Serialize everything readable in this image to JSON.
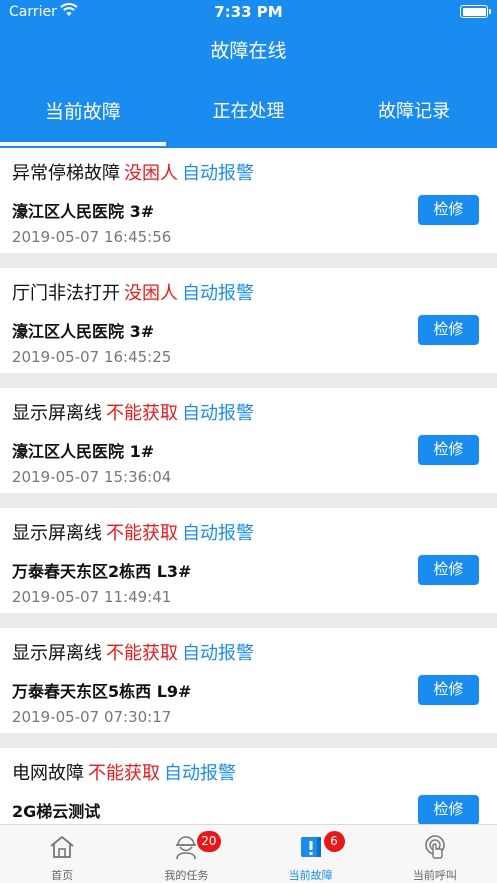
{
  "status_bar": {
    "carrier": "Carrier",
    "time": "7:33 PM"
  },
  "header": {
    "title": "故障在线"
  },
  "tabs": [
    {
      "label": "当前故障"
    },
    {
      "label": "正在处理"
    },
    {
      "label": "故障记录"
    }
  ],
  "faults": [
    {
      "fault": "异常停梯故障",
      "condition": "没困人",
      "alarm": "自动报警",
      "location": "濠江区人民医院 3#",
      "time": "2019-05-07 16:45:56",
      "action": "检修"
    },
    {
      "fault": "厅门非法打开",
      "condition": "没困人",
      "alarm": "自动报警",
      "location": "濠江区人民医院 3#",
      "time": "2019-05-07 16:45:25",
      "action": "检修"
    },
    {
      "fault": "显示屏离线",
      "condition": "不能获取",
      "alarm": "自动报警",
      "location": "濠江区人民医院 1#",
      "time": "2019-05-07 15:36:04",
      "action": "检修"
    },
    {
      "fault": "显示屏离线",
      "condition": "不能获取",
      "alarm": "自动报警",
      "location": "万泰春天东区2栋西 L3#",
      "time": "2019-05-07 11:49:41",
      "action": "检修"
    },
    {
      "fault": "显示屏离线",
      "condition": "不能获取",
      "alarm": "自动报警",
      "location": "万泰春天东区5栋西 L9#",
      "time": "2019-05-07 07:30:17",
      "action": "检修"
    },
    {
      "fault": "电网故障",
      "condition": "不能获取",
      "alarm": "自动报警",
      "location": "2G梯云测试",
      "time": "",
      "action": "检修"
    }
  ],
  "tab_bar": [
    {
      "label": "首页",
      "icon": "home-icon",
      "badge": ""
    },
    {
      "label": "我的任务",
      "icon": "worker-icon",
      "badge": "20"
    },
    {
      "label": "当前故障",
      "icon": "alert-book-icon",
      "badge": "6"
    },
    {
      "label": "当前呼叫",
      "icon": "touch-call-icon",
      "badge": ""
    }
  ],
  "colors": {
    "primary": "#1a8cf0",
    "danger": "#f01a1a",
    "badge": "#e8181a"
  }
}
